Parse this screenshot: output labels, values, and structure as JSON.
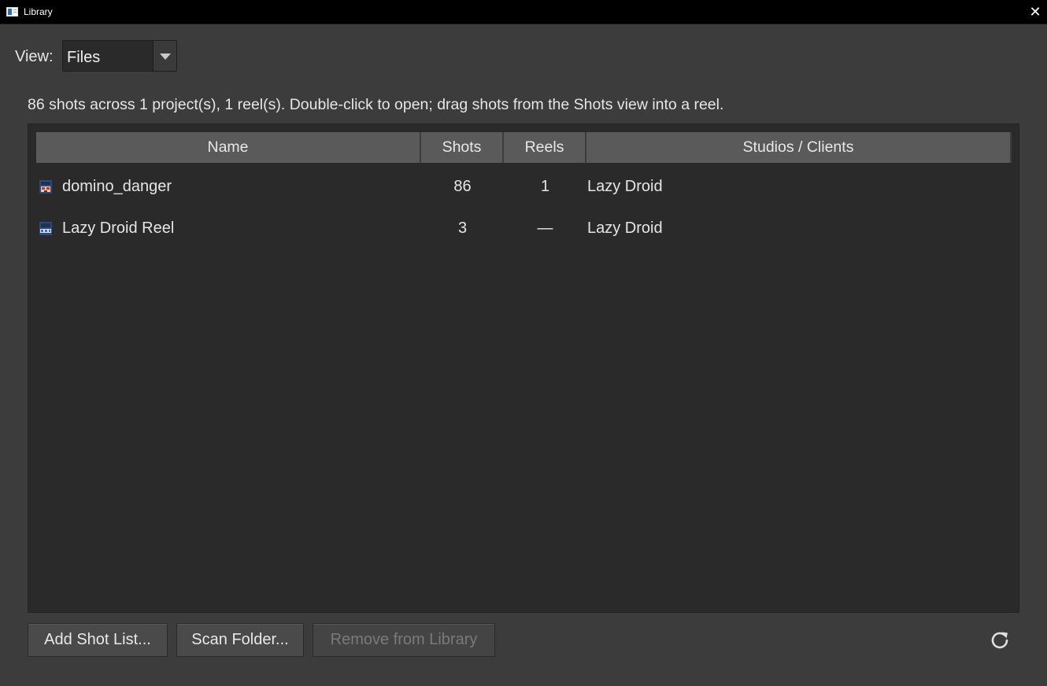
{
  "window": {
    "title": "Library",
    "close_glyph": "✕"
  },
  "view": {
    "label": "View:",
    "selected": "Files"
  },
  "summary": "86 shots across 1 project(s), 1 reel(s). Double-click to open; drag shots from the Shots view into a reel.",
  "table": {
    "columns": {
      "name": "Name",
      "shots": "Shots",
      "reels": "Reels",
      "studios": "Studios / Clients"
    },
    "rows": [
      {
        "icon": "project-icon",
        "name": "domino_danger",
        "shots": "86",
        "reels": "1",
        "studios": "Lazy Droid"
      },
      {
        "icon": "reel-icon",
        "name": "Lazy Droid Reel",
        "shots": "3",
        "reels": "—",
        "studios": "Lazy Droid"
      }
    ]
  },
  "buttons": {
    "add_shot_list": "Add Shot List...",
    "scan_folder": "Scan Folder...",
    "remove_from_library": "Remove from Library"
  },
  "icons": {
    "refresh": "refresh-icon",
    "app": "library-app-icon"
  },
  "colors": {
    "window_bg": "#3c3c3c",
    "titlebar_bg": "#000000",
    "panel_bg": "#2a2a2a",
    "header_bg": "#5a5a5a",
    "disabled_text": "#7a7a7a"
  }
}
